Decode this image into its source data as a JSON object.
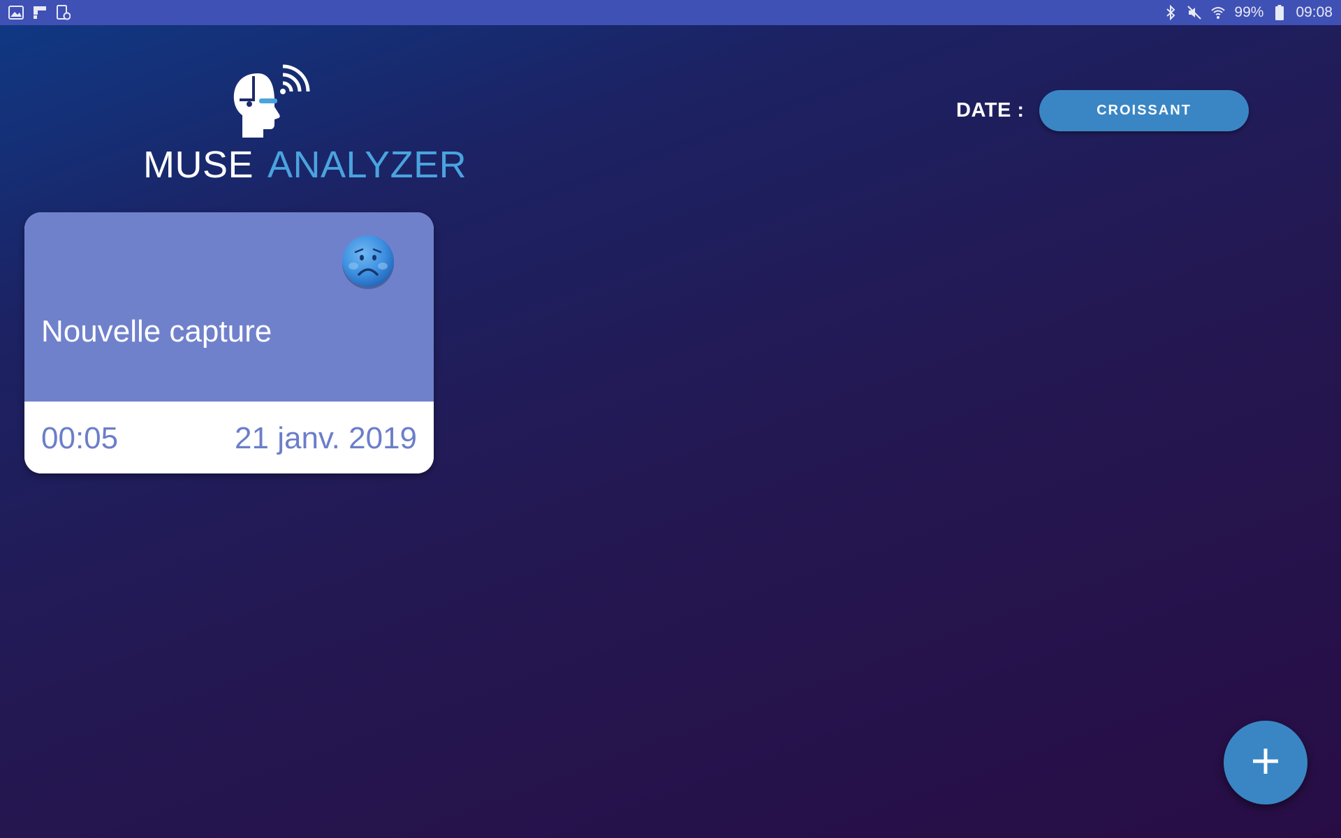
{
  "status_bar": {
    "left_icons": [
      "gallery-icon",
      "flipboard-icon",
      "screen-recorder-icon"
    ],
    "right_icons": [
      "bluetooth-icon",
      "mute-icon",
      "wifi-icon"
    ],
    "battery": "99%",
    "time": "09:08",
    "color": "#3f51b5"
  },
  "app": {
    "logo_word1": "MUSE",
    "logo_word2": "ANALYZER",
    "logo_icon": "head-signal-icon",
    "accent_color": "#4aa3df"
  },
  "sort": {
    "label": "DATE :",
    "button_label": "CROISSANT",
    "button_color": "#3a86c5"
  },
  "captures": [
    {
      "title": "Nouvelle capture",
      "mood_icon": "sad-face-icon",
      "duration": "00:05",
      "date": "21 janv. 2019",
      "card_color": "#7081cc"
    }
  ],
  "fab": {
    "icon": "plus-icon",
    "color": "#3a86c5"
  }
}
